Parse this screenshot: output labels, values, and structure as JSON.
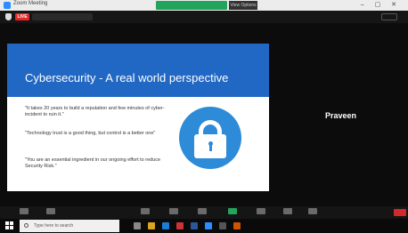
{
  "window": {
    "title": "Zoom Meeting",
    "view_tab": "View Options"
  },
  "infobar": {
    "live_badge": "LIVE"
  },
  "slide": {
    "title": "Cybersecurity - A real world perspective",
    "quotes": [
      "\"It takes 20 years to build a reputation and few minutes of cyber-incident to ruin it.\"",
      "\"Technology trust is a good thing, but control is a better one\"",
      "\"You are an essential ingredient in our ongoing effort to reduce Security Risk.\""
    ]
  },
  "participant": {
    "name": "Praveen"
  },
  "taskbar": {
    "search_placeholder": "Type here to search"
  },
  "colors": {
    "slide_header": "#2167c4",
    "lock_circle": "#2e8bd8",
    "live": "#e02828",
    "share_bar": "#22a45a"
  }
}
